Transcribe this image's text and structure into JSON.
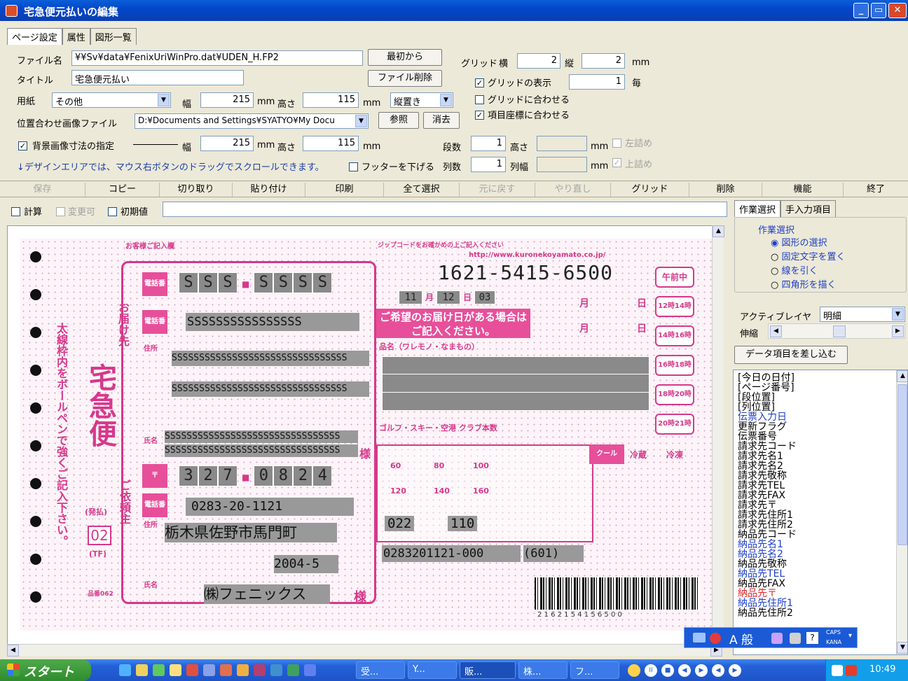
{
  "window": {
    "title": "宅急便元払いの編集"
  },
  "tabs": [
    {
      "label": "ページ設定",
      "active": true
    },
    {
      "label": "属性",
      "active": false
    },
    {
      "label": "図形一覧",
      "active": false
    }
  ],
  "page_settings": {
    "file_label": "ファイル名",
    "file_value": "¥¥Sv¥data¥FenixUriWinPro.dat¥UDEN_H.FP2",
    "from_start_button": "最初から",
    "title_label": "タイトル",
    "title_value": "宅急便元払い",
    "delete_file_button": "ファイル削除",
    "paper_label": "用紙",
    "paper_value": "その他",
    "width_label": "幅",
    "width_value": "215",
    "height_label": "高さ",
    "height_value": "115",
    "unit_mm": "mm",
    "orientation_value": "縦置き",
    "align_image_label": "位置合わせ画像ファイル",
    "align_image_value": "D:¥Documents and Settings¥SYATYO¥My Docu",
    "browse_button": "参照",
    "clear_button": "消去",
    "bg_size_label": "背景画像寸法の指定",
    "bg_width_value": "215",
    "bg_height_value": "115",
    "rows_label": "段数",
    "rows_value": "1",
    "row_height_label": "高さ",
    "left_align_label": "左詰め",
    "cols_label": "列数",
    "cols_value": "1",
    "col_width_label": "列幅",
    "top_align_label": "上詰め",
    "footer_label": "フッターを下げる",
    "scroll_note": "↓デザインエリアでは、マウス右ボタンのドラッグでスクロールできます。"
  },
  "grid_settings": {
    "grid_label": "グリッド",
    "horizontal_label": "横",
    "horizontal_value": "2",
    "vertical_label": "縦",
    "vertical_value": "2",
    "unit": "mm",
    "show_grid_label": "グリッドの表示",
    "show_grid_checked": true,
    "every_value": "1",
    "every_label": "毎",
    "snap_grid_label": "グリッドに合わせる",
    "snap_grid_checked": false,
    "snap_item_label": "項目座標に合わせる",
    "snap_item_checked": true
  },
  "toolbar": [
    {
      "label": "保存",
      "enabled": false
    },
    {
      "label": "コピー",
      "enabled": true
    },
    {
      "label": "切り取り",
      "enabled": true
    },
    {
      "label": "貼り付け",
      "enabled": true
    },
    {
      "label": "印刷",
      "enabled": true
    },
    {
      "label": "全て選択",
      "enabled": true
    },
    {
      "label": "元に戻す",
      "enabled": false
    },
    {
      "label": "やり直し",
      "enabled": false
    },
    {
      "label": "グリッド",
      "enabled": true
    },
    {
      "label": "削除",
      "enabled": true
    },
    {
      "label": "機能",
      "enabled": true
    },
    {
      "label": "終了",
      "enabled": true
    }
  ],
  "options": {
    "calc_label": "計算",
    "changeable_label": "変更可",
    "initial_label": "初期値"
  },
  "slip": {
    "tracking_number": "1621-5415-6500",
    "top_note_left": "お客様ご記入欄",
    "top_note_right": "ジップコードをお確かめの上ご記入ください",
    "url_text": "http://www.kuronekoyamato.co.jp/",
    "time_slots": [
      "午前中",
      "12時14時",
      "14時16時",
      "16時18時",
      "18時20時",
      "20時21時"
    ],
    "sender_phone_digits": [
      "S",
      "S",
      "S",
      "S",
      "S",
      "S",
      "S"
    ],
    "sender_phone_sep": "■",
    "recipient_name_field": "SSSSSSSSSSSSSSSS",
    "address_line1": "SSSSSSSSSSSSSSSSSSSSSSSSSSSSSSSS",
    "address_line2": "SSSSSSSSSSSSSSSSSSSSSSSSSSSSSSSS",
    "name_line1": "SSSSSSSSSSSSSSSSSSSSSSSSSSSSSSSS",
    "name_line2": "SSSSSSSSSSSSSSSSSSSSSSSSSSSSSSSS",
    "sama": "様",
    "ship_month": "11",
    "ship_day": "12",
    "ship_num": "03",
    "month_label": "月",
    "day_label": "日",
    "pref_date_note": "ご希望のお届け日がある場合はご記入ください。",
    "goods_label": "品名（ワレモノ・なまもの）",
    "golf_ski_label": "ゴルフ・スキー・空港 クラブ本数",
    "zip_digits": [
      "3",
      "2",
      "7",
      "0",
      "8",
      "2",
      "4"
    ],
    "client_phone": "0283-20-1121",
    "client_address": "栃木県佐野市馬門町",
    "client_date": "2004-5",
    "client_name": "㈱フェニックス",
    "code1": "022",
    "code2": "110",
    "customer_code": "0283201121-000",
    "customer_code_suffix": "(601)",
    "sizes": [
      "60",
      "80",
      "100",
      "120",
      "140",
      "160"
    ],
    "cool_labels": [
      "冷蔵",
      "冷凍"
    ],
    "left_vertical": "太線枠内をボールペンで強くご記入下さい。",
    "brand_vertical": "宅急便",
    "payment_type": "(発払)",
    "slip_type": "02",
    "tf_label": "(TF)",
    "recipient_vertical": "お届け先",
    "client_vertical": "ご依頼主",
    "tel_label": "電話番号",
    "address_label": "住所",
    "name_label": "氏名",
    "form_number": "品番062",
    "barcode_digits": "2 1 6 2 1 5 4 1 5 6 5 0 0"
  },
  "right_panel": {
    "tabs": [
      "作業選択",
      "手入力項目"
    ],
    "group_label": "作業選択",
    "radio_options": [
      {
        "label": "図形の選択",
        "selected": true
      },
      {
        "label": "固定文字を置く",
        "selected": false
      },
      {
        "label": "線を引く",
        "selected": false
      },
      {
        "label": "四角形を描く",
        "selected": false
      }
    ],
    "active_layer_label": "アクティブレイヤ",
    "active_layer_value": "明細",
    "zoom_label": "伸縮",
    "insert_data_button": "データ項目を差し込む",
    "data_items": [
      {
        "label": "[今日の日付]",
        "color": "black"
      },
      {
        "label": "[ページ番号]",
        "color": "black"
      },
      {
        "label": "[段位置]",
        "color": "black"
      },
      {
        "label": "[列位置]",
        "color": "black"
      },
      {
        "label": "伝票入力日",
        "color": "blue"
      },
      {
        "label": "更新フラグ",
        "color": "black"
      },
      {
        "label": "伝票番号",
        "color": "black"
      },
      {
        "label": "請求先コード",
        "color": "black"
      },
      {
        "label": "請求先名1",
        "color": "black"
      },
      {
        "label": "請求先名2",
        "color": "black"
      },
      {
        "label": "請求先敬称",
        "color": "black"
      },
      {
        "label": "請求先TEL",
        "color": "black"
      },
      {
        "label": "請求先FAX",
        "color": "black"
      },
      {
        "label": "請求先〒",
        "color": "black"
      },
      {
        "label": "請求先住所1",
        "color": "black"
      },
      {
        "label": "請求先住所2",
        "color": "black"
      },
      {
        "label": "納品先コード",
        "color": "black"
      },
      {
        "label": "納品先名1",
        "color": "blue"
      },
      {
        "label": "納品先名2",
        "color": "blue"
      },
      {
        "label": "納品先敬称",
        "color": "black"
      },
      {
        "label": "納品先TEL",
        "color": "blue"
      },
      {
        "label": "納品先FAX",
        "color": "black"
      },
      {
        "label": "納品先〒",
        "color": "red"
      },
      {
        "label": "納品先住所1",
        "color": "blue"
      },
      {
        "label": "納品先住所2",
        "color": "black"
      }
    ]
  },
  "ime_bar": {
    "mode_text": "A 般",
    "caps": "CAPS",
    "kana": "KANA"
  },
  "taskbar": {
    "start_label": "スタート",
    "items": [
      "受...",
      "Y...",
      "販...",
      "株...",
      "フ..."
    ],
    "clock": "10:49"
  }
}
